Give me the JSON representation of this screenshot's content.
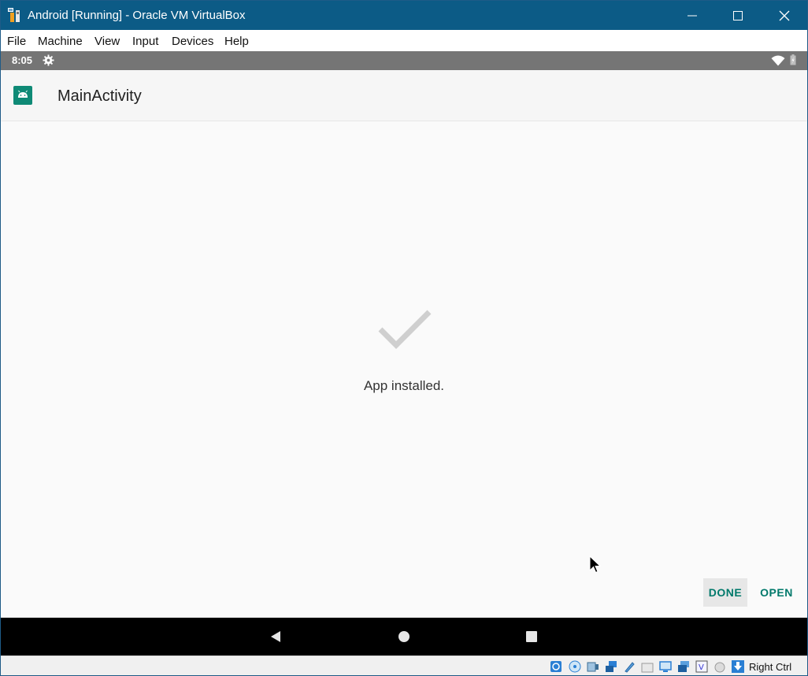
{
  "window": {
    "title": "Android [Running] - Oracle VM VirtualBox",
    "controls": [
      "minimize-icon",
      "maximize-icon",
      "close-icon"
    ]
  },
  "menubar": {
    "items": [
      {
        "label": "File"
      },
      {
        "label": "Machine"
      },
      {
        "label": "View"
      },
      {
        "label": "Input"
      },
      {
        "label": "Devices"
      },
      {
        "label": "Help"
      }
    ]
  },
  "android": {
    "status": {
      "time": "8:05",
      "icons": [
        "gear-icon",
        "wifi-icon",
        "battery-icon"
      ]
    },
    "appbar": {
      "title": "MainActivity",
      "icon": "android-app-icon"
    },
    "content": {
      "message": "App installed.",
      "icon": "checkmark-icon"
    },
    "actions": {
      "done": "DONE",
      "open": "OPEN"
    },
    "nav": [
      "back-icon",
      "home-icon",
      "recents-icon"
    ]
  },
  "vbox_status": {
    "host_key": "Right Ctrl",
    "icons": [
      "hard-disk-icon",
      "optical-drive-icon",
      "audio-icon",
      "network-icon",
      "usb-icon",
      "shared-folders-icon",
      "display-icon",
      "video-capture-icon",
      "virtualization-icon",
      "mouse-integration-icon",
      "keyboard-capture-icon"
    ]
  },
  "colors": {
    "titlebar": "#0c5b86",
    "statusbar": "#757575",
    "accent": "#00796b",
    "check": "#cfcfcf"
  }
}
